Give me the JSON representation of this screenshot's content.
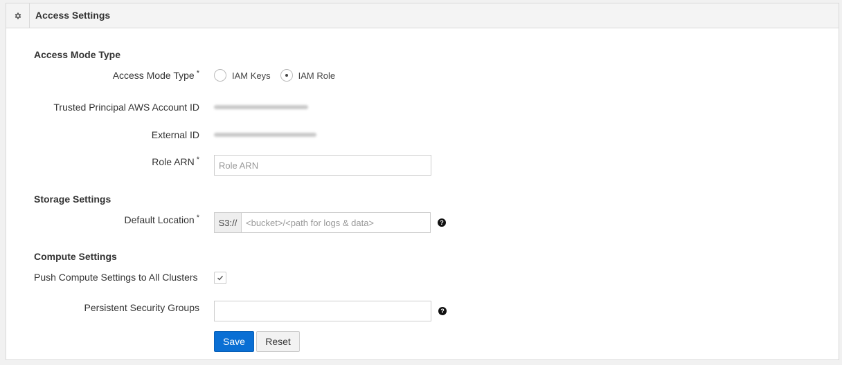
{
  "header": {
    "icon": "gear-icon",
    "title": "Access Settings"
  },
  "access_mode": {
    "section_title": "Access Mode Type",
    "label": "Access Mode Type",
    "required_mark": "*",
    "options": [
      {
        "label": "IAM Keys",
        "selected": false
      },
      {
        "label": "IAM Role",
        "selected": true
      }
    ]
  },
  "trusted_principal": {
    "label": "Trusted Principal AWS Account ID"
  },
  "external_id": {
    "label": "External ID"
  },
  "role_arn": {
    "label": "Role ARN",
    "required_mark": "*",
    "value": "",
    "placeholder": "Role ARN"
  },
  "storage": {
    "section_title": "Storage Settings",
    "default_location_label": "Default Location",
    "required_mark": "*",
    "prefix": "S3://",
    "value": "",
    "placeholder": "<bucket>/<path for logs & data>",
    "help_icon": "question-circle-icon"
  },
  "compute": {
    "section_title": "Compute Settings",
    "push_label": "Push Compute Settings to All Clusters",
    "push_checked": true,
    "security_groups_label": "Persistent Security Groups",
    "security_groups_value": "",
    "help_icon": "question-circle-icon"
  },
  "actions": {
    "save_label": "Save",
    "reset_label": "Reset"
  },
  "colors": {
    "primary_button": "#0a6fd4",
    "panel_border": "#d9d9d9",
    "header_bg": "#f4f4f4"
  }
}
